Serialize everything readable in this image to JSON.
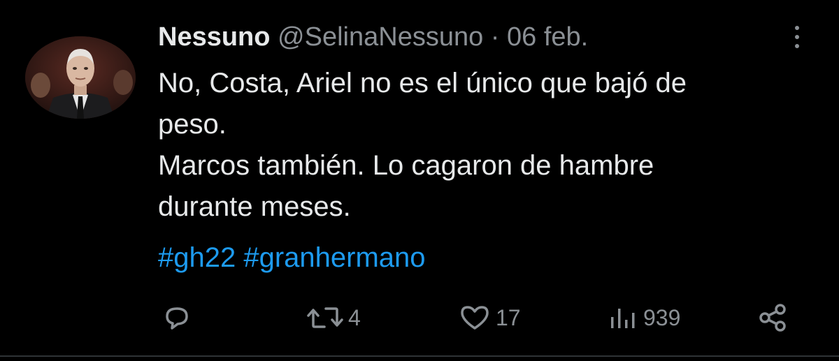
{
  "tweet": {
    "display_name": "Nessuno",
    "handle": "@SelinaNessuno",
    "separator": "·",
    "date": "06 feb.",
    "text_lines": [
      "No, Costa, Ariel no es el único que bajó de",
      "peso.",
      "Marcos también. Lo cagaron de hambre",
      "durante meses."
    ],
    "hashtags": [
      "#gh22",
      "#granhermano"
    ]
  },
  "actions": {
    "reply_icon": "reply-icon",
    "retweet_icon": "retweet-icon",
    "retweet_count": "4",
    "like_icon": "heart-icon",
    "like_count": "17",
    "views_icon": "views-bar-icon",
    "views_count": "939",
    "share_icon": "share-icon"
  },
  "colors": {
    "background": "#000000",
    "text": "#e7e9ea",
    "muted": "#8b9095",
    "hashtag": "#1d9bf0"
  }
}
